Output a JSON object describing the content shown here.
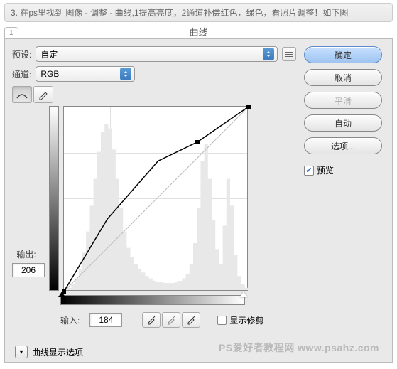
{
  "header": {
    "instruction": "3. 在ps里找到 图像 - 调整 - 曲线,1提高亮度，2通道补偿红色，绿色，看照片调整！如下图"
  },
  "tab": {
    "corner": "1",
    "title": "曲线"
  },
  "preset": {
    "label": "预设:",
    "value": "自定"
  },
  "channel": {
    "label": "通道:",
    "value": "RGB"
  },
  "output": {
    "label": "输出:",
    "value": "206"
  },
  "input": {
    "label": "输入:",
    "value": "184"
  },
  "show_clipping": "显示修剪",
  "disclosure": "曲线显示选项",
  "buttons": {
    "ok": "确定",
    "cancel": "取消",
    "smooth": "平滑",
    "auto": "自动",
    "options": "选项..."
  },
  "preview": "预览",
  "watermark": "PS爱好者教程网 www.psahz.com",
  "chart_data": {
    "type": "line",
    "title": "曲线",
    "xlabel": "输入",
    "ylabel": "输出",
    "xlim": [
      0,
      255
    ],
    "ylim": [
      0,
      255
    ],
    "series": [
      {
        "name": "baseline",
        "x": [
          0,
          255
        ],
        "y": [
          0,
          255
        ]
      },
      {
        "name": "curve",
        "x": [
          0,
          60,
          130,
          184,
          255
        ],
        "y": [
          0,
          100,
          180,
          206,
          255
        ]
      }
    ],
    "control_points": [
      {
        "x": 0,
        "y": 0
      },
      {
        "x": 184,
        "y": 206
      },
      {
        "x": 255,
        "y": 255
      }
    ],
    "histogram": [
      0,
      2,
      5,
      10,
      18,
      32,
      50,
      72,
      95,
      118,
      135,
      142,
      138,
      120,
      95,
      70,
      50,
      36,
      28,
      22,
      18,
      15,
      12,
      10,
      8,
      7,
      7,
      6,
      6,
      6,
      7,
      8,
      10,
      14,
      22,
      40,
      70,
      110,
      125,
      95,
      60,
      35,
      22,
      55,
      95,
      72,
      30,
      12,
      5,
      2
    ]
  }
}
